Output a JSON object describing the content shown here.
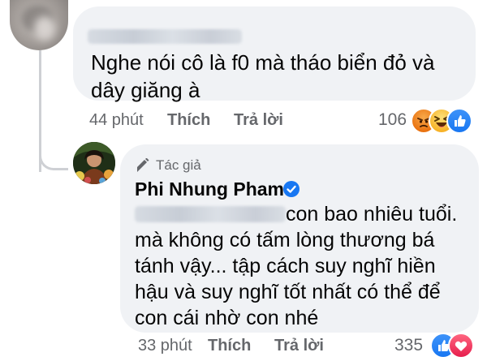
{
  "comment": {
    "text": "Nghe nói cô là f0 mà tháo biển đỏ và dây giăng à",
    "time": "44 phút",
    "like_label": "Thích",
    "reply_label": "Trả lời",
    "reaction_count": "106",
    "reactions": [
      "angry-emoji",
      "haha-emoji",
      "like-icon"
    ]
  },
  "reply": {
    "author_badge": "Tác giả",
    "author_name": "Phi Nhung Pham",
    "lines": [
      "con bao nhiêu tuổi.",
      "mà không có tấm lòng thương bá",
      "tánh vậy... tập cách suy nghĩ hiền",
      "hậu và suy nghĩ tốt nhất có thể để",
      "con cái nhờ con nhé"
    ],
    "time": "33 phút",
    "like_label": "Thích",
    "reply_label": "Trả lời",
    "reaction_count": "335",
    "reactions": [
      "like-icon",
      "love-icon"
    ]
  },
  "colors": {
    "bubble": "#f0f2f5",
    "secondary_text": "#65676b",
    "like_blue": "#1877f2",
    "love_red": "#f33e58",
    "angry_orange": "#e9710f",
    "haha_yellow": "#f7b125"
  }
}
